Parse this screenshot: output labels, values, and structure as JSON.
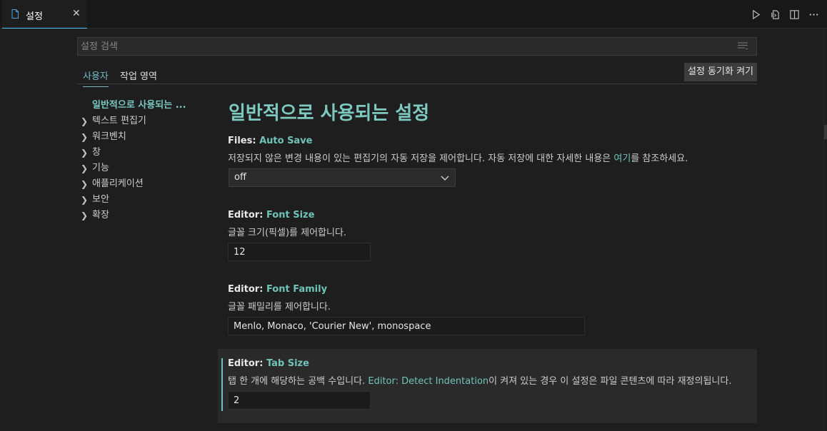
{
  "tab": {
    "title": "설정",
    "close": "✕"
  },
  "toolbar": {
    "run_icon": "play-icon",
    "open_json_icon": "open-json-icon",
    "split_icon": "split-editor-icon",
    "more_icon": "more-icon"
  },
  "search": {
    "placeholder": "설정 검색",
    "value": ""
  },
  "scopes": {
    "user": "사용자",
    "workspace": "작업 영역"
  },
  "sync_button": "설정 동기화 켜기",
  "toc": [
    {
      "label": "일반적으로 사용되는 ...",
      "active": true,
      "expandable": false
    },
    {
      "label": "텍스트 편집기",
      "active": false,
      "expandable": true
    },
    {
      "label": "워크벤치",
      "active": false,
      "expandable": true
    },
    {
      "label": "창",
      "active": false,
      "expandable": true
    },
    {
      "label": "기능",
      "active": false,
      "expandable": true
    },
    {
      "label": "애플리케이션",
      "active": false,
      "expandable": true
    },
    {
      "label": "보안",
      "active": false,
      "expandable": true
    },
    {
      "label": "확장",
      "active": false,
      "expandable": true
    }
  ],
  "section_title": "일반적으로 사용되는 설정",
  "settings": {
    "auto_save": {
      "category": "Files: ",
      "key": "Auto Save",
      "desc_before": "저장되지 않은 변경 내용이 있는 편집기의 자동 저장을 제어합니다. 자동 저장에 대한 자세한 내용은 ",
      "desc_link": "여기",
      "desc_after": "를 참조하세요.",
      "value": "off"
    },
    "font_size": {
      "category": "Editor: ",
      "key": "Font Size",
      "desc": "글꼴 크기(픽셀)를 제어합니다.",
      "value": "12"
    },
    "font_family": {
      "category": "Editor: ",
      "key": "Font Family",
      "desc": "글꼴 패밀리를 제어합니다.",
      "value": "Menlo, Monaco, 'Courier New', monospace"
    },
    "tab_size": {
      "category": "Editor: ",
      "key": "Tab Size",
      "desc_before": "탭 한 개에 해당하는 공백 수입니다. ",
      "desc_link": "Editor: Detect Indentation",
      "desc_after": "이 켜져 있는 경우 이 설정은 파일 콘텐츠에 따라 재정의됩니다.",
      "value": "2"
    }
  },
  "colors": {
    "accent": "#6fc3ba",
    "background": "#1e1e1e",
    "tabbar": "#181818",
    "focus_row": "#2a2a2a"
  }
}
